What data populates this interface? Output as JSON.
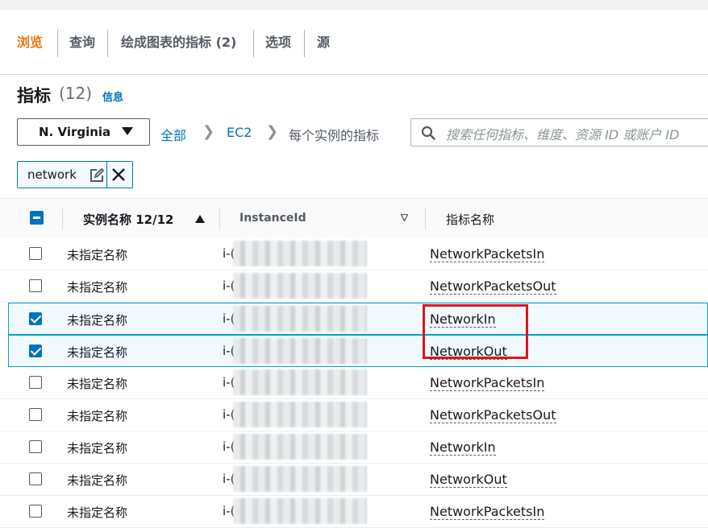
{
  "tabs": [
    {
      "label": "浏览",
      "active": true
    },
    {
      "label": "查询",
      "active": false
    },
    {
      "label": "绘成图表的指标 (2)",
      "active": false
    },
    {
      "label": "选项",
      "active": false
    },
    {
      "label": "源",
      "active": false
    }
  ],
  "header": {
    "title": "指标",
    "count": "(12)",
    "info_link": "信息"
  },
  "filters": {
    "region": "N. Virginia",
    "breadcrumb": [
      "全部",
      "EC2",
      "每个实例的指标"
    ],
    "search_placeholder": "搜索任何指标、维度、资源 ID 或账户 ID",
    "token": "network"
  },
  "table": {
    "columns": {
      "instance_name": "实例名称 12/12",
      "instance_id": "InstanceId",
      "metric_name": "指标名称"
    },
    "rows": [
      {
        "name": "未指定名称",
        "id_prefix": "i-(",
        "metric": "NetworkPacketsIn",
        "selected": false
      },
      {
        "name": "未指定名称",
        "id_prefix": "i-(",
        "metric": "NetworkPacketsOut",
        "selected": false
      },
      {
        "name": "未指定名称",
        "id_prefix": "i-(",
        "metric": "NetworkIn",
        "selected": true
      },
      {
        "name": "未指定名称",
        "id_prefix": "i-(",
        "metric": "NetworkOut",
        "selected": true
      },
      {
        "name": "未指定名称",
        "id_prefix": "i-(",
        "metric": "NetworkPacketsIn",
        "selected": false
      },
      {
        "name": "未指定名称",
        "id_prefix": "i-(",
        "metric": "NetworkPacketsOut",
        "selected": false
      },
      {
        "name": "未指定名称",
        "id_prefix": "i-(",
        "metric": "NetworkIn",
        "selected": false
      },
      {
        "name": "未指定名称",
        "id_prefix": "i-(",
        "metric": "NetworkOut",
        "selected": false
      },
      {
        "name": "未指定名称",
        "id_prefix": "i-(",
        "metric": "NetworkPacketsIn",
        "selected": false
      }
    ]
  },
  "colors": {
    "accent": "#ec7211",
    "link": "#0073bb",
    "selected_row": "#f1faff",
    "annotation": "#e0141e"
  }
}
